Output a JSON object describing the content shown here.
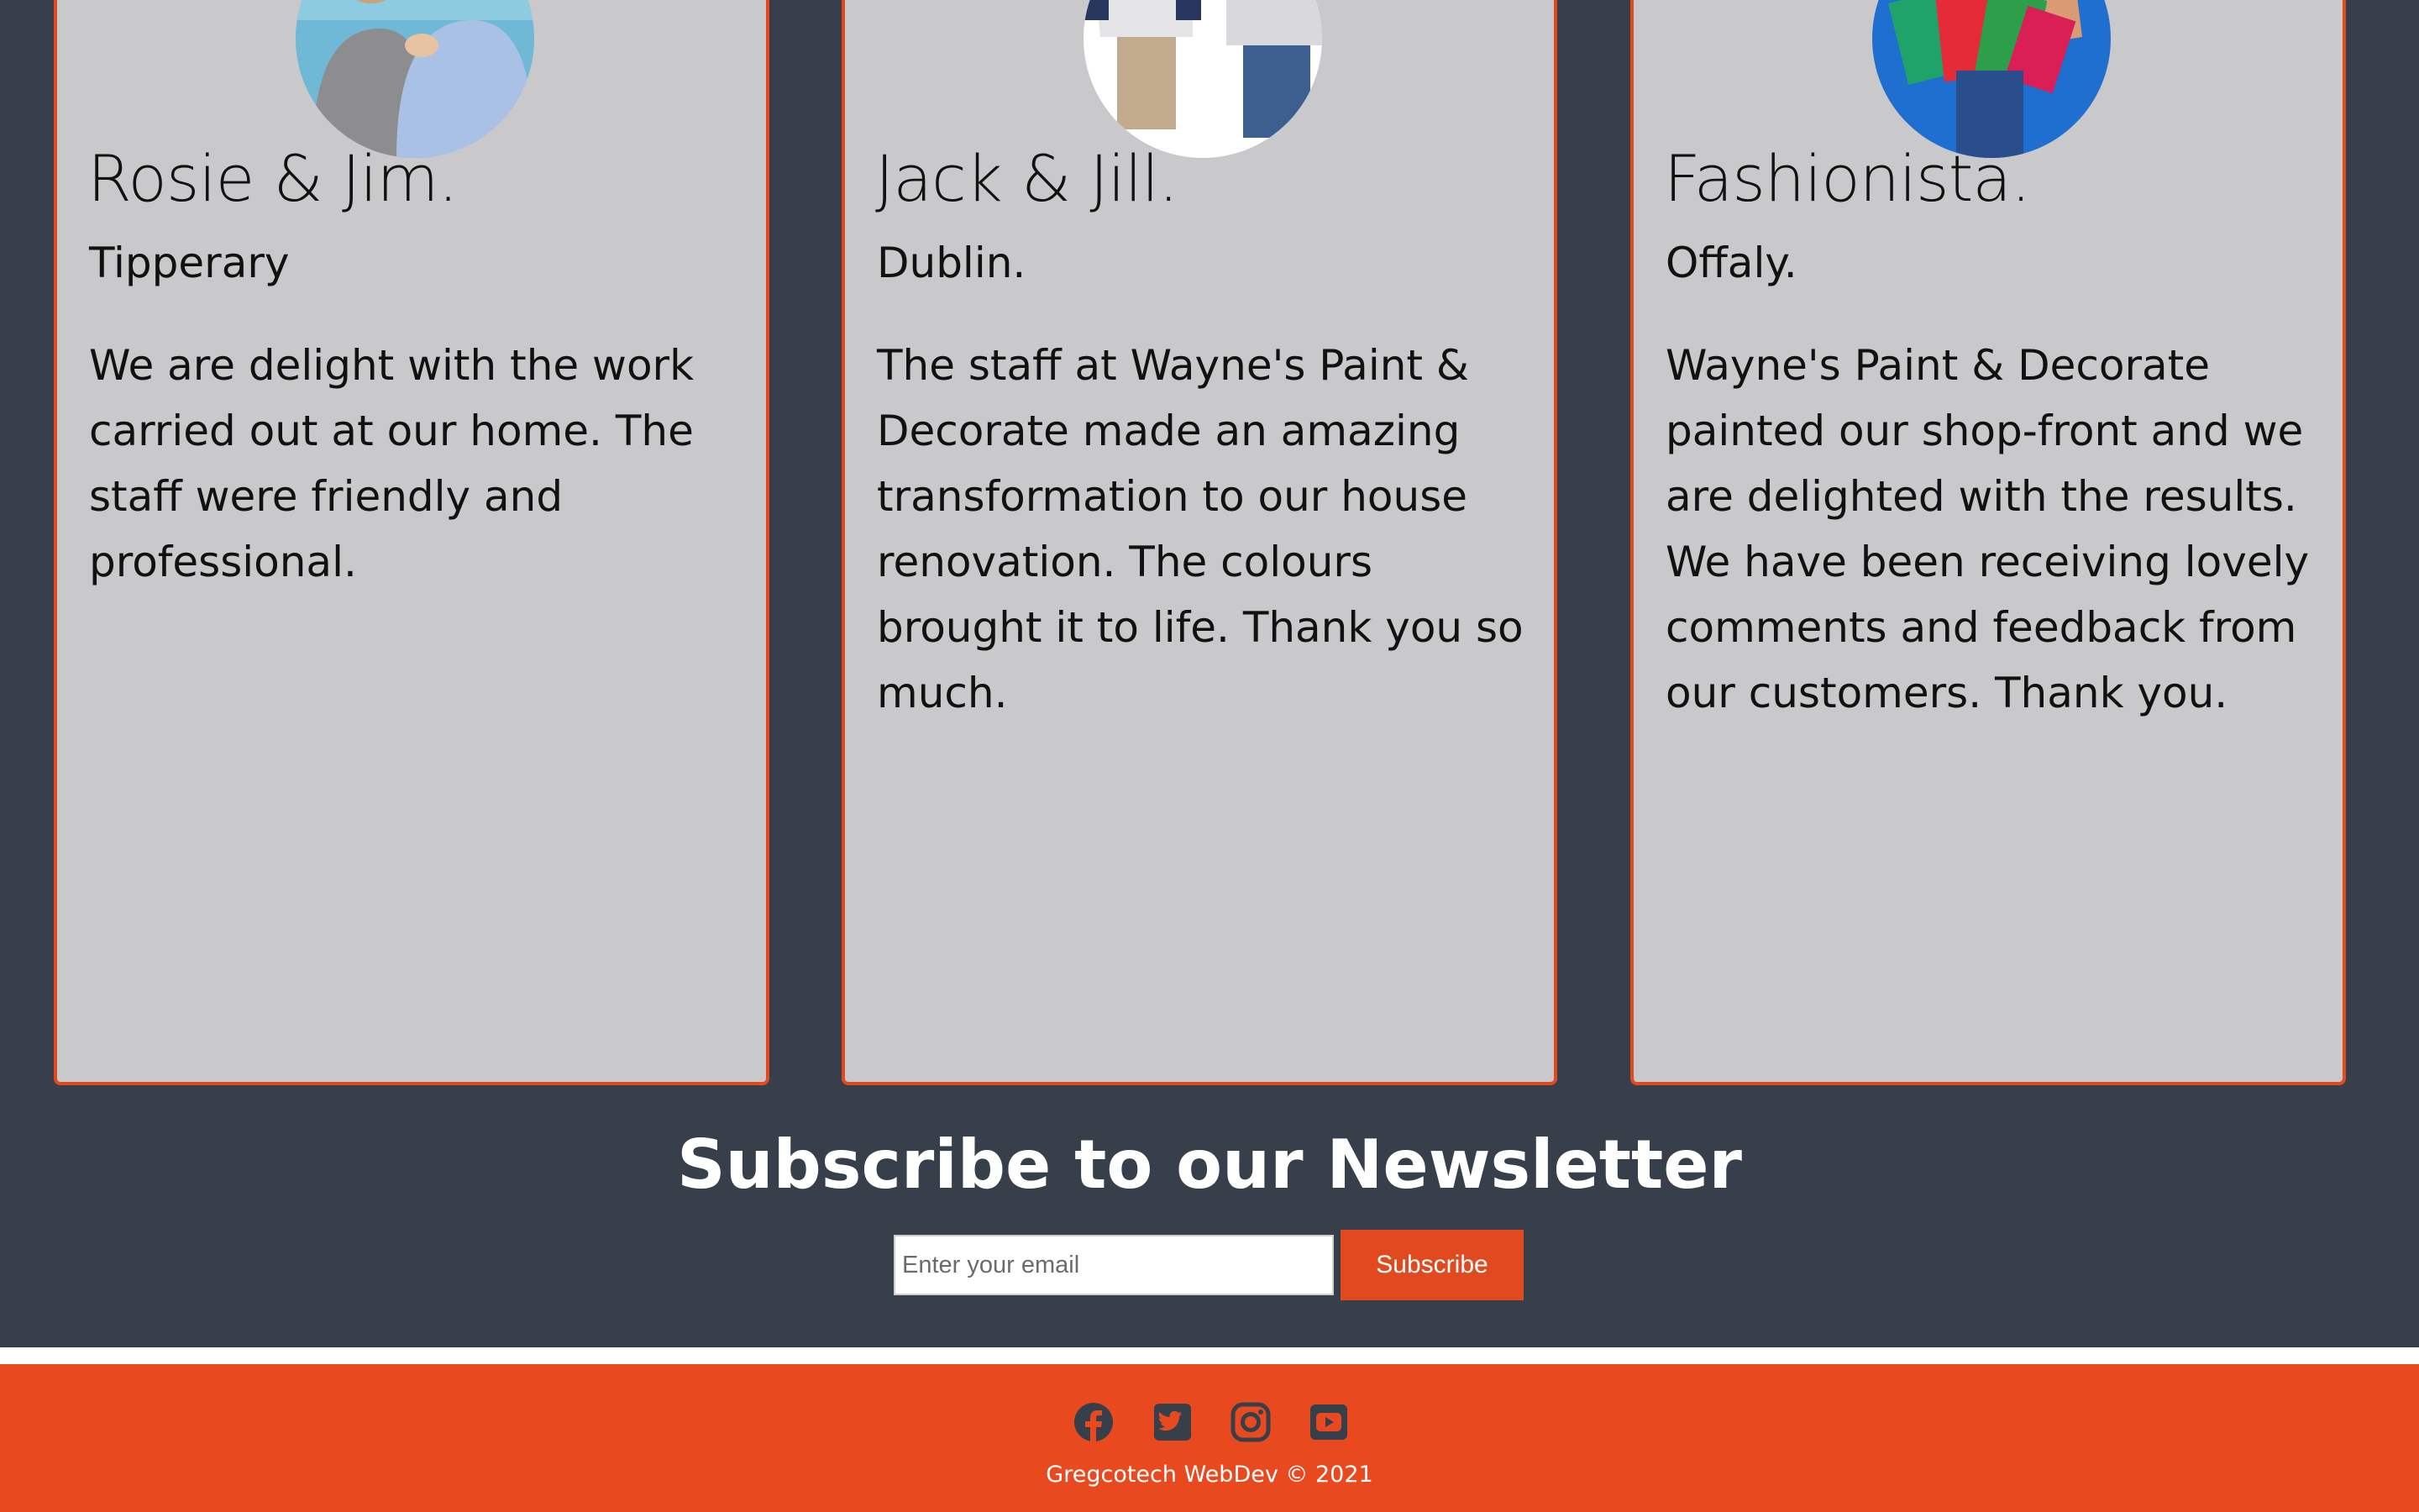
{
  "testimonials": [
    {
      "name": "Rosie & Jim.",
      "location": "Tipperary",
      "text": "We are delight with the work carried out at our home. The staff were friendly and professional.",
      "avatar_icon": "couple-photo"
    },
    {
      "name": "Jack & Jill.",
      "location": "Dublin.",
      "text": "The staff at Wayne's Paint & Decorate made an amazing transformation to our house renovation. The colours brought it to life. Thank you so much.",
      "avatar_icon": "kids-photo"
    },
    {
      "name": "Fashionista.",
      "location": "Offaly.",
      "text": "Wayne's Paint & Decorate painted our shop-front and we are delighted with the results. We have been receiving lovely comments and feedback from our customers. Thank you.",
      "avatar_icon": "shopping-bags-photo"
    }
  ],
  "newsletter": {
    "title": "Subscribe to our Newsletter",
    "email_placeholder": "Enter your email",
    "email_value": "",
    "subscribe_label": "Subscribe"
  },
  "footer": {
    "social_icons": [
      "facebook-icon",
      "twitter-icon",
      "instagram-icon",
      "youtube-icon"
    ],
    "copyright": "Gregcotech WebDev © 2021"
  },
  "colors": {
    "page_background": "#37404a",
    "card_background": "#c9c8ca",
    "accent": "#e14a1e",
    "footer_background": "#e8491f",
    "icon_color": "#37404a"
  }
}
